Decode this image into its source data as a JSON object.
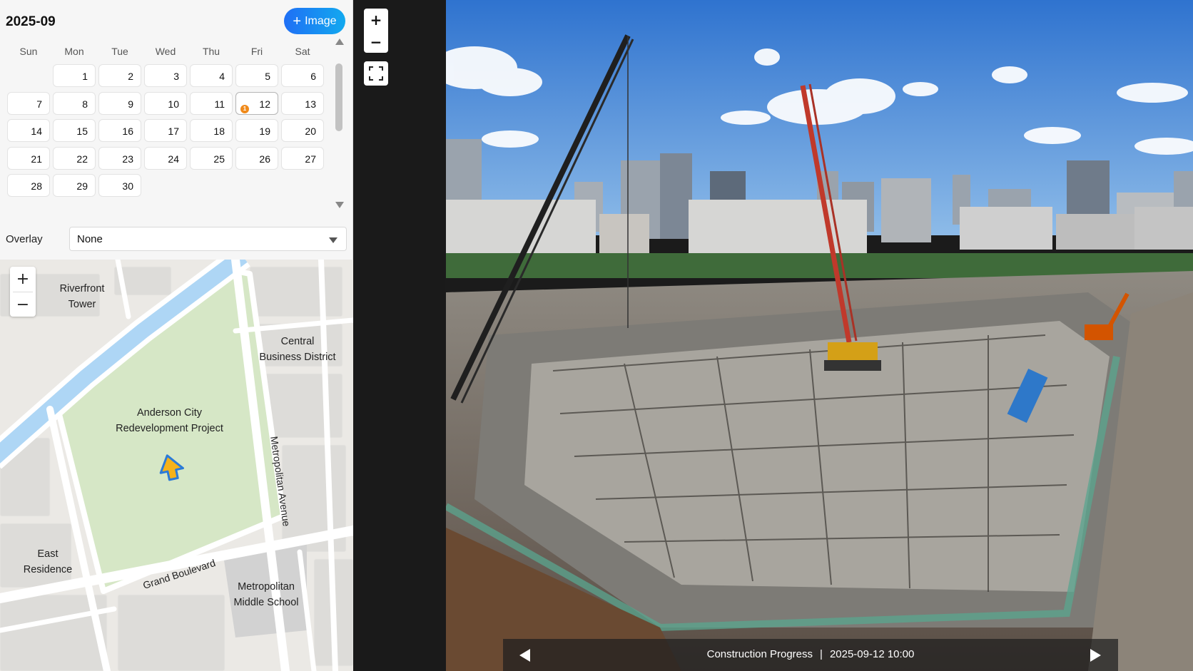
{
  "calendar": {
    "month_title": "2025-09",
    "add_image_label": "Image",
    "weekdays": [
      "Sun",
      "Mon",
      "Tue",
      "Wed",
      "Thu",
      "Fri",
      "Sat"
    ],
    "leading_blanks": 1,
    "days": [
      "1",
      "2",
      "3",
      "4",
      "5",
      "6",
      "7",
      "8",
      "9",
      "10",
      "11",
      "12",
      "13",
      "14",
      "15",
      "16",
      "17",
      "18",
      "19",
      "20",
      "21",
      "22",
      "23",
      "24",
      "25",
      "26",
      "27",
      "28",
      "29",
      "30"
    ],
    "selected_day": "12",
    "badge_day": "12",
    "badge_text": "1",
    "badge_color": "#f08a1a"
  },
  "overlay": {
    "label": "Overlay",
    "selected": "None"
  },
  "map": {
    "zoom_in": "+",
    "zoom_out": "−",
    "labels": {
      "riverfront": "Riverfront\nTower",
      "cbd": "Central\nBusiness District",
      "project": "Anderson City\nRedevelopment Project",
      "metropolitan_ave": "Metropolitan Avenue",
      "grand_blvd": "Grand Boulevard",
      "east_residence": "East\nResidence",
      "middle_school": "Metropolitan\nMiddle School"
    },
    "colors": {
      "water": "#a9d4f5",
      "park": "#d8e8c8",
      "block": "#dcdcdc",
      "road": "#ffffff",
      "marker": "#f5b21a",
      "marker_outline": "#2b7bd8"
    }
  },
  "viewer": {
    "zoom_in": "+",
    "zoom_out": "−",
    "caption_title": "Construction Progress",
    "caption_separator": "|",
    "caption_time": "2025-09-12 10:00"
  },
  "colors": {
    "accent_start": "#1f6ff5",
    "accent_end": "#12a9ef",
    "panel_bg": "#f6f6f6",
    "dark_bg": "#1a1a1a"
  }
}
